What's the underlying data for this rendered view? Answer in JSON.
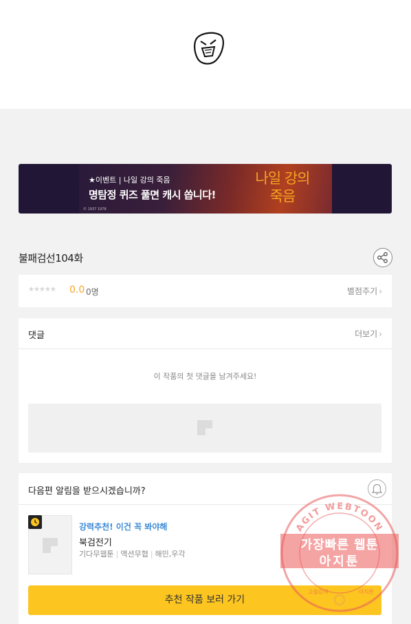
{
  "banner": {
    "event_text": "★이벤트 | 나일 강의 죽음",
    "headline": "명탐정 퀴즈 풀면 캐시 쏩니다!",
    "copyright": "© 1937 1978",
    "logo_text": "나일 강의 죽음"
  },
  "episode": {
    "title": "불패검선104화"
  },
  "rating": {
    "stars": "★★★★★",
    "score": "0.0",
    "count": "0명",
    "rate_link": "별점주기",
    "chevron": "›"
  },
  "comments": {
    "label": "댓글",
    "more_link": "더보기",
    "chevron": "›",
    "empty_message": "이 작품의 첫 댓글을 남겨주세요!"
  },
  "alert": {
    "question": "다음편 알림을 받으시겠습니까?"
  },
  "recommendation": {
    "tag": "강력추천! 이건 꼭 봐야해",
    "title": "북검전기",
    "meta": [
      "기다무웹툰",
      "액션무협",
      "해민,우각"
    ],
    "separator": "|",
    "button_label": "추천 작품 보러 가기"
  },
  "watermark": {
    "ring_top": "AGIT WEBTOON",
    "line1": "가장빠른 웹툰",
    "line2": "아지툰",
    "bottom_left": "고퀄검색",
    "bottom_right": "아지툰"
  },
  "colors": {
    "accent_yellow": "#fcc520",
    "score_orange": "#f5a623",
    "tag_blue": "#3d8bd6",
    "stamp_red": "#e85a5a"
  },
  "icons": {
    "logo": "scribble-face-icon",
    "share": "share-icon",
    "bell": "bell-icon",
    "badge": "clock-icon",
    "placeholder": "image-placeholder-icon"
  }
}
